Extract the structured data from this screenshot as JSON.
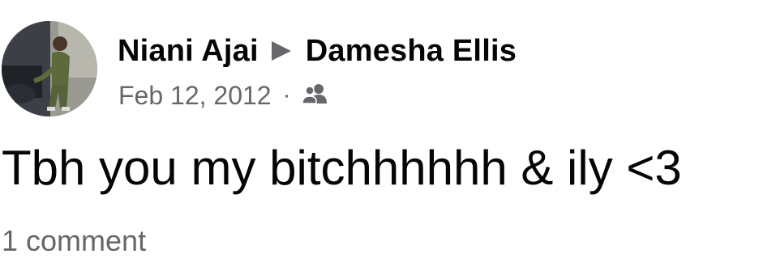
{
  "post": {
    "author": {
      "name": "Niani Ajai",
      "avatar_icon": "profile-photo"
    },
    "recipient": {
      "name": "Damesha Ellis"
    },
    "separator_icon": "right-triangle-arrow-icon",
    "date": "Feb 12, 2012",
    "dot": "·",
    "audience_icon": "friends-icon",
    "text": "Tbh you my bitchhhhhh & ily <3",
    "comments_label": "1 comment"
  },
  "colors": {
    "primary_text": "#050505",
    "secondary_text": "#65676b",
    "background": "#ffffff"
  }
}
